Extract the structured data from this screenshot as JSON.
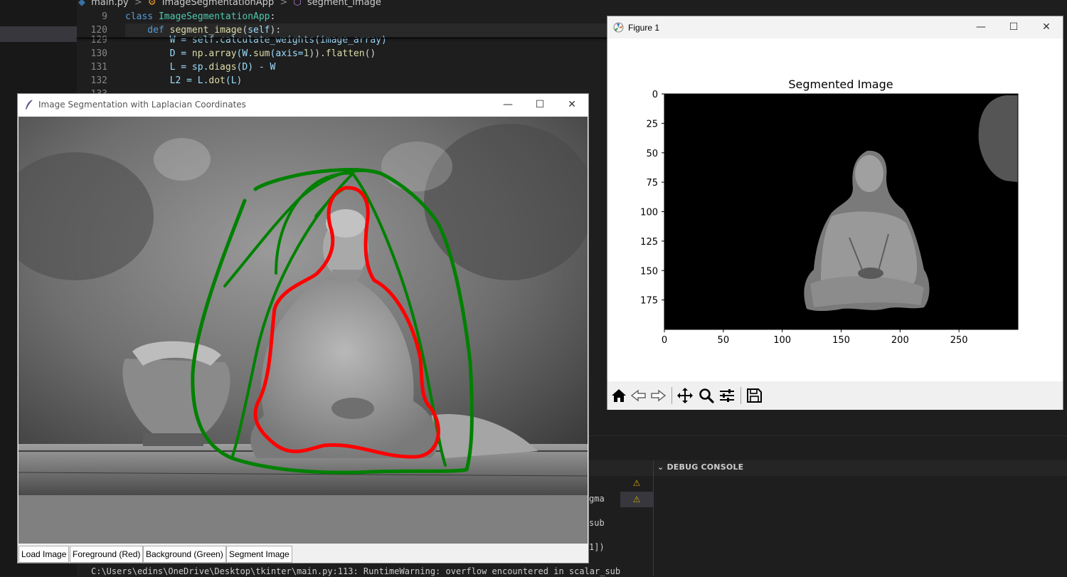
{
  "vscode": {
    "breadcrumb": {
      "file": "main.py",
      "class_name": "ImageSegmentationApp",
      "method_name": "segment_image",
      "separator": ">"
    },
    "sticky_lines": [
      {
        "num": "9",
        "parts": [
          {
            "t": "class ",
            "c": "kw"
          },
          {
            "t": "ImageSegmentationApp",
            "c": "cls"
          },
          {
            "t": ":",
            "c": "txt"
          }
        ]
      },
      {
        "num": "120",
        "parts": [
          {
            "t": "    def ",
            "c": "kw"
          },
          {
            "t": "segment_image",
            "c": "fn"
          },
          {
            "t": "(",
            "c": "txt"
          },
          {
            "t": "self",
            "c": "var"
          },
          {
            "t": "):",
            "c": "txt"
          }
        ]
      }
    ],
    "code_lines": [
      {
        "num": "129",
        "parts": [
          {
            "t": "        W = self.calculate_weights(image_array)",
            "c": "var"
          }
        ]
      },
      {
        "num": "130",
        "parts": [
          {
            "t": "        D = ",
            "c": "var"
          },
          {
            "t": "np.array",
            "c": "fn"
          },
          {
            "t": "(W.",
            "c": "var"
          },
          {
            "t": "sum",
            "c": "fn"
          },
          {
            "t": "(axis=",
            "c": "var"
          },
          {
            "t": "1",
            "c": "num"
          },
          {
            "t": ")).",
            "c": "txt"
          },
          {
            "t": "flatten",
            "c": "fn"
          },
          {
            "t": "()",
            "c": "txt"
          }
        ]
      },
      {
        "num": "131",
        "parts": [
          {
            "t": "        L = sp.",
            "c": "var"
          },
          {
            "t": "diags",
            "c": "fn"
          },
          {
            "t": "(D) - W",
            "c": "var"
          }
        ]
      },
      {
        "num": "132",
        "parts": [
          {
            "t": "        L2 = L.",
            "c": "var"
          },
          {
            "t": "dot",
            "c": "fn"
          },
          {
            "t": "(L)",
            "c": "var"
          }
        ]
      },
      {
        "num": "133",
        "parts": [
          {
            "t": "",
            "c": "txt"
          }
        ]
      }
    ],
    "debug_console_label": "DEBUG CONSOLE",
    "terminal_fragments": [
      "gma",
      "sub",
      "1])"
    ],
    "terminal_bottom": "C:\\Users\\edins\\OneDrive\\Desktop\\tkinter\\main.py:113: RuntimeWarning: overflow encountered in scalar_sub",
    "warning_icon": "warning-icon"
  },
  "tk_app": {
    "title": "Image Segmentation with Laplacian Coordinates",
    "buttons": [
      "Load Image",
      "Foreground (Red)",
      "Background (Green)",
      "Segment Image"
    ],
    "stroke_colors": {
      "foreground": "#ff0000",
      "background": "#008000"
    },
    "window_controls": {
      "minimize": "—",
      "maximize": "☐",
      "close": "✕"
    }
  },
  "figure": {
    "window_title": "Figure 1",
    "window_controls": {
      "minimize": "—",
      "maximize": "☐",
      "close": "✕"
    },
    "toolbar_icons": [
      "home-icon",
      "back-icon",
      "forward-icon",
      "pan-icon",
      "zoom-icon",
      "configure-subplots-icon",
      "save-icon"
    ]
  },
  "chart_data": {
    "type": "image",
    "title": "Segmented Image",
    "xlabel": "",
    "ylabel": "",
    "x_ticks": [
      0,
      50,
      100,
      150,
      200,
      250
    ],
    "y_ticks": [
      0,
      25,
      50,
      75,
      100,
      125,
      150,
      175
    ],
    "xlim": [
      0,
      300
    ],
    "ylim": [
      200,
      0
    ],
    "background_color": "#000000",
    "grid": false
  }
}
